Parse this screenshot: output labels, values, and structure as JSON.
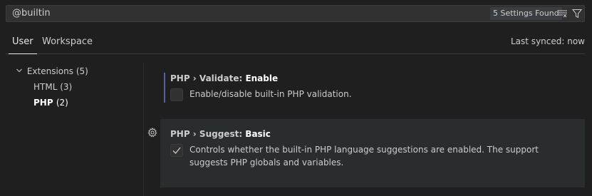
{
  "search": {
    "value": "@builtin",
    "result_count": "5 Settings Found",
    "clear_icon": "clear-filter-icon",
    "filter_icon": "filter-icon"
  },
  "tabs": {
    "user": "User",
    "workspace": "Workspace",
    "last_synced": "Last synced: now"
  },
  "toc": {
    "extensions": {
      "label": "Extensions",
      "count": "(5)"
    },
    "html": {
      "label": "HTML",
      "count": "(3)"
    },
    "php": {
      "label": "PHP",
      "count": "(2)"
    }
  },
  "settings": [
    {
      "category": "PHP › Validate: ",
      "name": "Enable",
      "checked": false,
      "description": "Enable/disable built-in PHP validation."
    },
    {
      "category": "PHP › Suggest: ",
      "name": "Basic",
      "checked": true,
      "description": "Controls whether the built-in PHP language suggestions are enabled. The support suggests PHP globals and variables."
    }
  ],
  "colors": {
    "background": "#1f1f1f",
    "input_background": "#313131",
    "hover_row": "#2a2d2e",
    "focus_bar": "#5a5fa0"
  }
}
